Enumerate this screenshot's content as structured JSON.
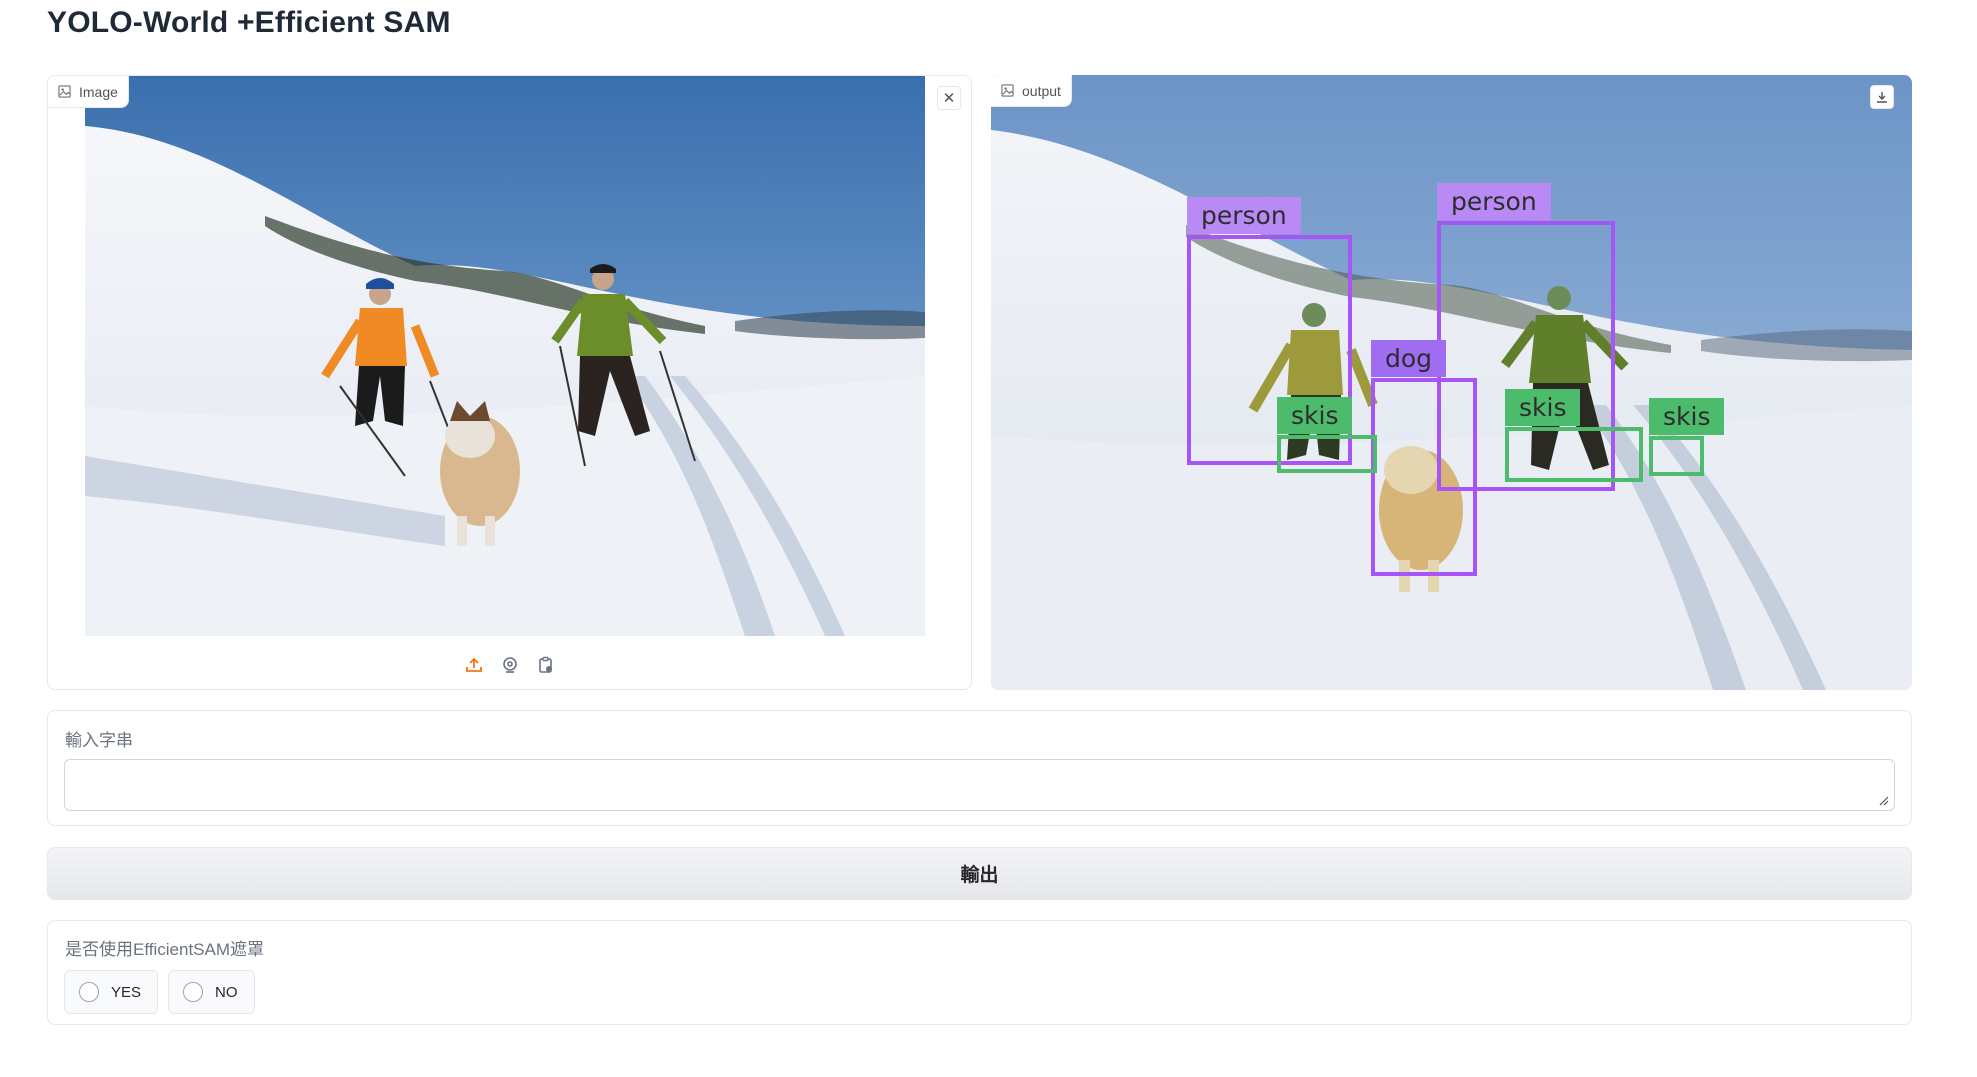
{
  "app": {
    "title": "YOLO-World +Efficient SAM"
  },
  "input_image": {
    "label": "Image",
    "label_icon": "image-icon",
    "close_icon": "close-icon",
    "source_buttons": [
      {
        "name": "upload-icon",
        "color": "#f97316"
      },
      {
        "name": "webcam-icon",
        "color": "#6b7280"
      },
      {
        "name": "clipboard-icon",
        "color": "#6b7280"
      }
    ]
  },
  "output_image": {
    "label": "output",
    "label_icon": "image-icon",
    "download_icon": "download-icon",
    "detections": [
      {
        "label": "person",
        "color": "#a855f7"
      },
      {
        "label": "person",
        "color": "#a855f7"
      },
      {
        "label": "dog",
        "color": "#a855f7"
      },
      {
        "label": "skis",
        "color": "#4cbb6c"
      },
      {
        "label": "skis",
        "color": "#4cbb6c"
      },
      {
        "label": "skis",
        "color": "#4cbb6c"
      }
    ]
  },
  "text_input": {
    "label": "輸入字串",
    "value": "",
    "placeholder": ""
  },
  "submit": {
    "label": "輸出"
  },
  "mask_option": {
    "label": "是否使用EfficientSAM遮罩",
    "options": [
      "YES",
      "NO"
    ],
    "selected": null
  }
}
